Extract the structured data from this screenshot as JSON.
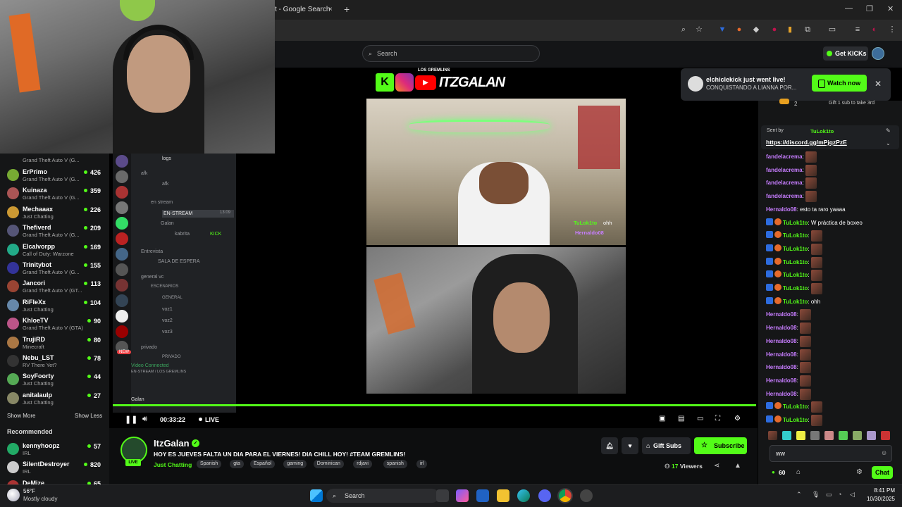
{
  "browser": {
    "tab_title": "t - Google Search",
    "tab_close": "×",
    "new_tab": "+",
    "minimize": "—",
    "restore": "❐",
    "close": "✕"
  },
  "header": {
    "search_placeholder": "Search",
    "get_kicks": "Get KICKs"
  },
  "notification": {
    "title": "elchiclekick just went live!",
    "subtitle": "CONQUISTANDO A LIANNA POR...",
    "watch_label": "Watch now",
    "close": "✕"
  },
  "overlay": {
    "team_label": "LOS GREMLINS",
    "brand": "ITZGALAN"
  },
  "sidebar": {
    "channels": [
      {
        "name": "ErPrimo",
        "category": "Grand Theft Auto V (G...",
        "viewers": "426"
      },
      {
        "name": "Kuinaza",
        "category": "Grand Theft Auto V (G...",
        "viewers": "359"
      },
      {
        "name": "Mechaaax",
        "category": "Just Chatting",
        "viewers": "226"
      },
      {
        "name": "Thefiverd",
        "category": "Grand Theft Auto V (G...",
        "viewers": "209"
      },
      {
        "name": "Elcalvorpp",
        "category": "Call of Duty: Warzone",
        "viewers": "169"
      },
      {
        "name": "Trinitybot",
        "category": "Grand Theft Auto V (G...",
        "viewers": "155"
      },
      {
        "name": "Jancori",
        "category": "Grand Theft Auto V (GT...",
        "viewers": "113"
      },
      {
        "name": "RiFleXx",
        "category": "Just Chatting",
        "viewers": "104"
      },
      {
        "name": "KhloeTV",
        "category": "Grand Theft Auto V (GTA)",
        "viewers": "90"
      },
      {
        "name": "TrujiRD",
        "category": "Minecraft",
        "viewers": "80"
      },
      {
        "name": "Nebu_LST",
        "category": "RV There Yet?",
        "viewers": "78"
      },
      {
        "name": "SoyFoorty",
        "category": "Just Chatting",
        "viewers": "44"
      },
      {
        "name": "anitalaulp",
        "category": "Just Chatting",
        "viewers": "27"
      }
    ],
    "top_category": "Grand Theft Auto V (G...",
    "show_more": "Show More",
    "show_less": "Show Less",
    "recommended_heading": "Recommended",
    "recommended": [
      {
        "name": "kennyhoopz",
        "category": "IRL",
        "viewers": "57"
      },
      {
        "name": "SilentDestroyer",
        "category": "IRL",
        "viewers": "820"
      },
      {
        "name": "DeMize",
        "category": "",
        "viewers": "65"
      }
    ]
  },
  "discord": {
    "logs": "logs",
    "afk_cat": "afk",
    "afk": "afk",
    "en_stream_cat": "en stream",
    "en_stream": "EN-STREAM",
    "en_stream_time": "13:09",
    "user_galan": "Galan",
    "user_kabrita": "kabrita",
    "kick": "KICK",
    "entrevista": "Entrevista",
    "sala": "SALA DE ESPERA",
    "general_vc": "general vc",
    "escenarios": "ESCENARIOS",
    "general": "GENERAL",
    "voz1": "voz1",
    "voz2": "voz2",
    "voz3": "voz3",
    "privado_cat": "privado",
    "privado": "PRIVADO",
    "new": "NEW",
    "video_connected": "Video Connected",
    "vc_sub": "EN-STREAM / LOS GREMLINS",
    "footer_user": "Galan"
  },
  "stream_overlay_chat": [
    {
      "user": "TuLok1to",
      "text": "ohh"
    },
    {
      "user": "Hernaldo08",
      "text": ""
    }
  ],
  "player": {
    "time": "00:33:22",
    "live": "LIVE"
  },
  "stream": {
    "streamer": "ItzGalan",
    "live_badge": "LIVE",
    "title": "HOY ES JUEVES FALTA UN DIA PARA EL VIERNES! DIA CHILL HOY! #TEAM GREMLINS!",
    "category": "Just Chatting",
    "tags": [
      "Spanish",
      "gta",
      "Español",
      "gaming",
      "Dominican",
      "rdjavi",
      "spanish",
      "irl"
    ],
    "gift_subs": "Gift Subs",
    "subscribe": "Subscribe",
    "viewers_count": "17",
    "viewers_label": "Viewers"
  },
  "chat": {
    "sub_goal": "Gift 1 sub to take 3rd",
    "sub_rank": "2",
    "pinned_by": "Sent by",
    "pinned_user": "TuLok1to",
    "pinned_link": "https://discord.gg/mPjqzPzE",
    "messages": [
      {
        "user": "fandelacrema",
        "text": "",
        "color": "#c77dff",
        "emote": true
      },
      {
        "user": "fandelacrema",
        "text": "",
        "color": "#c77dff",
        "emote": true
      },
      {
        "user": "fandelacrema",
        "text": "",
        "color": "#c77dff",
        "emote": true
      },
      {
        "user": "fandelacrema",
        "text": "",
        "color": "#c77dff",
        "emote": true
      },
      {
        "user": "Hernaldo08",
        "text": "esto ta raro yaaaa",
        "color": "#c77dff",
        "emote": false
      },
      {
        "user": "TuLok1to",
        "text": "W práctica de boxeo",
        "color": "#53fc18",
        "emote": false
      },
      {
        "user": "TuLok1to",
        "text": "",
        "color": "#53fc18",
        "emote": true
      },
      {
        "user": "TuLok1to",
        "text": "",
        "color": "#53fc18",
        "emote": true
      },
      {
        "user": "TuLok1to",
        "text": "",
        "color": "#53fc18",
        "emote": true
      },
      {
        "user": "TuLok1to",
        "text": "",
        "color": "#53fc18",
        "emote": true
      },
      {
        "user": "TuLok1to",
        "text": "",
        "color": "#53fc18",
        "emote": true
      },
      {
        "user": "TuLok1to",
        "text": "ohh",
        "color": "#53fc18",
        "emote": false
      },
      {
        "user": "Hernaldo08",
        "text": "",
        "color": "#c77dff",
        "emote": true
      },
      {
        "user": "Hernaldo08",
        "text": "",
        "color": "#c77dff",
        "emote": true
      },
      {
        "user": "Hernaldo08",
        "text": "",
        "color": "#c77dff",
        "emote": true
      },
      {
        "user": "Hernaldo08",
        "text": "",
        "color": "#c77dff",
        "emote": true
      },
      {
        "user": "Hernaldo08",
        "text": "",
        "color": "#c77dff",
        "emote": true
      },
      {
        "user": "Hernaldo08",
        "text": "",
        "color": "#c77dff",
        "emote": true
      },
      {
        "user": "Hernaldo08",
        "text": "",
        "color": "#c77dff",
        "emote": true
      },
      {
        "user": "TuLok1to",
        "text": "",
        "color": "#53fc18",
        "emote": true
      },
      {
        "user": "TuLok1to",
        "text": "",
        "color": "#53fc18",
        "emote": true
      }
    ],
    "input_value": "ww",
    "kicks_balance": "60",
    "send_label": "Chat"
  },
  "taskbar": {
    "temp": "56°F",
    "weather": "Mostly cloudy",
    "search": "Search",
    "time": "8:41 PM",
    "date": "10/30/2025"
  },
  "colors": {
    "kick_green": "#53fc18",
    "username_purple": "#c77dff"
  }
}
